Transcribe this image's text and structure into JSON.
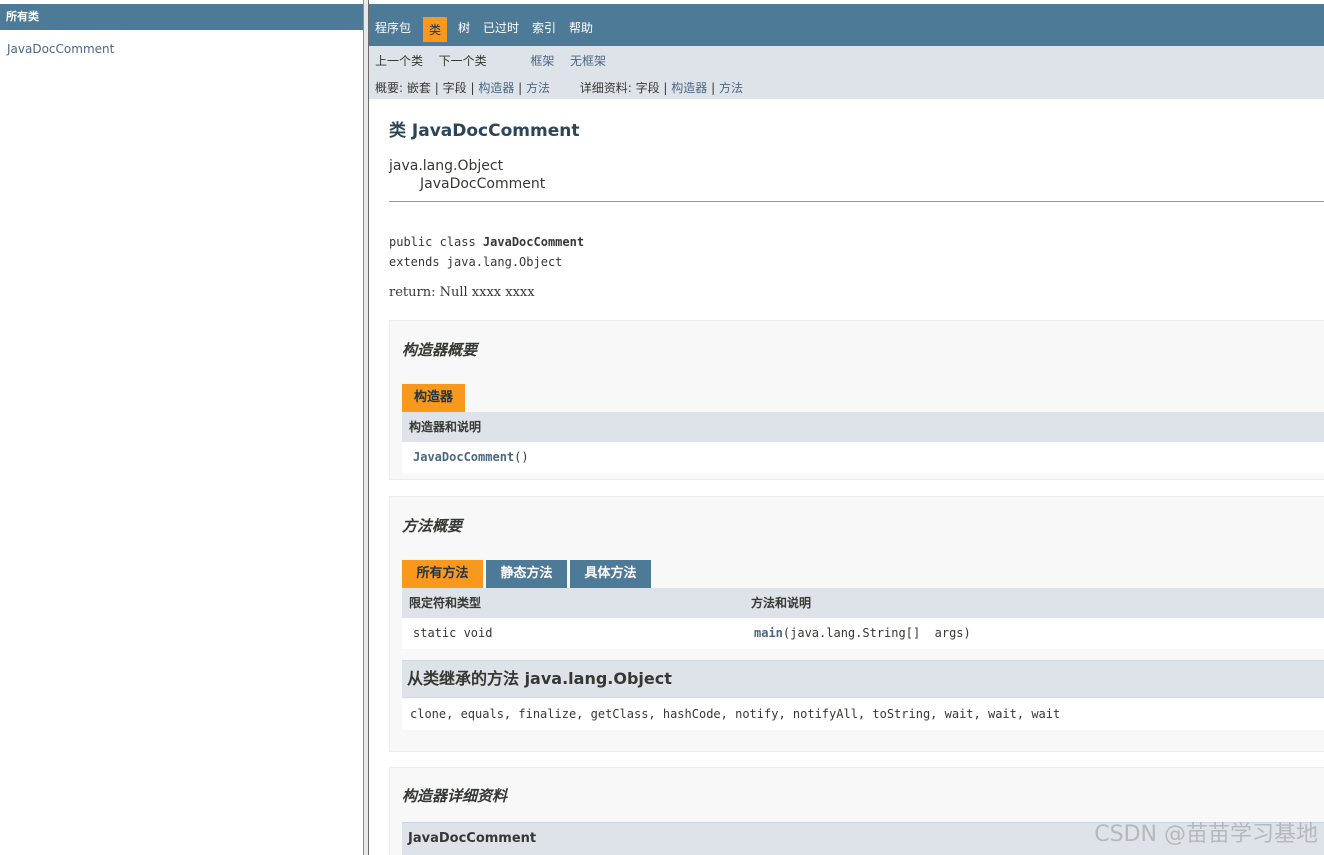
{
  "left_frame": {
    "header": "所有类",
    "classes": [
      "JavaDocComment"
    ]
  },
  "top_nav": {
    "items": [
      "程序包",
      "类",
      "树",
      "已过时",
      "索引",
      "帮助"
    ],
    "active": "类"
  },
  "sub_nav": {
    "prev_class": "上一个类",
    "next_class": "下一个类",
    "frames": "框架",
    "no_frames": "无框架",
    "summary_label": "概要:",
    "summary_nested": "嵌套",
    "summary_field": "字段",
    "summary_constructor": "构造器",
    "summary_method": "方法",
    "detail_label": "详细资料:",
    "detail_field": "字段",
    "detail_constructor": "构造器",
    "detail_method": "方法",
    "sep": "|"
  },
  "class_page": {
    "title": "类 JavaDocComment",
    "inheritance_parent": "java.lang.Object",
    "inheritance_child": "JavaDocComment",
    "sig_line1_prefix": "public class ",
    "sig_line1_name": "JavaDocComment",
    "sig_line2": "extends java.lang.Object",
    "description": "return: Null xxxx xxxx"
  },
  "constructor_summary": {
    "title": "构造器概要",
    "tab": "构造器",
    "column": "构造器和说明",
    "row_name": "JavaDocComment",
    "row_params": "()"
  },
  "method_summary": {
    "title": "方法概要",
    "tabs": [
      "所有方法",
      "静态方法",
      "具体方法"
    ],
    "col_modifier": "限定符和类型",
    "col_method": "方法和说明",
    "row_modifier": "static void",
    "row_method_name": "main",
    "row_method_params": "(java.lang.String[]  args)",
    "inherited_title": "从类继承的方法 java.lang.Object",
    "inherited_methods": "clone, equals, finalize, getClass, hashCode, notify, notifyAll, toString, wait, wait, wait"
  },
  "constructor_detail": {
    "title": "构造器详细资料",
    "item": "JavaDocComment"
  },
  "watermark": "CSDN @苗苗学习基地",
  "colors": {
    "nav_blue": "#4d7a97",
    "active_orange": "#f8981d",
    "subnav_gray": "#dee3e9",
    "link": "#4a6782"
  }
}
